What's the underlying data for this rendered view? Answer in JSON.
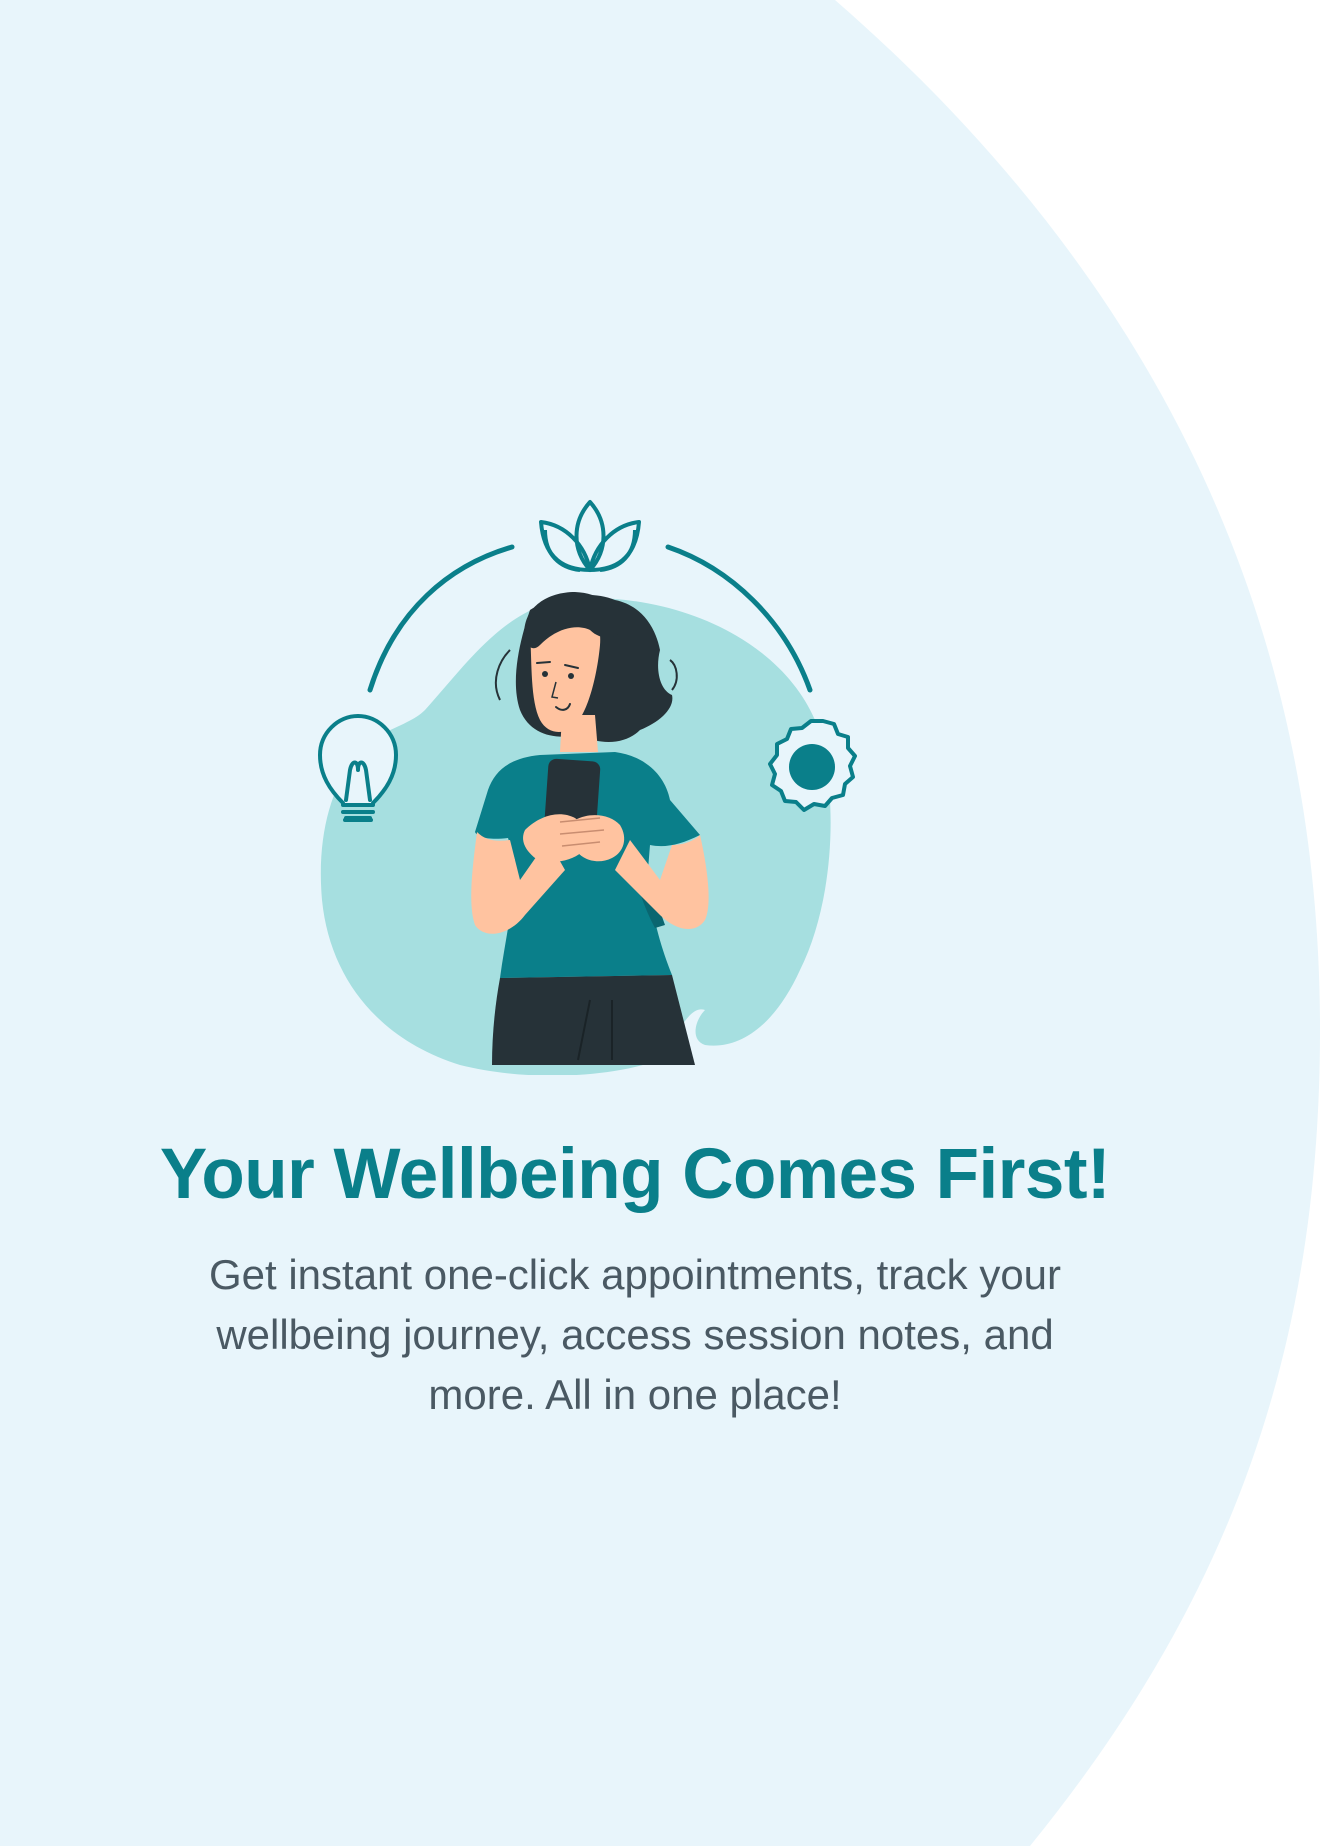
{
  "onboarding": {
    "headline": "Your Wellbeing Comes First!",
    "description": "Get instant one-click appointments, track your wellbeing journey, access session notes, and more. All in one place!"
  },
  "illustration": {
    "subject": "woman-using-phone",
    "icons": [
      "lotus-icon",
      "lightbulb-icon",
      "gear-icon"
    ]
  },
  "colors": {
    "background_light": "#e8f5fb",
    "accent_teal": "#0a7f8a",
    "blob": "#a6dfe0",
    "hair_dark": "#263238",
    "skin": "#ffc3a0",
    "body_text": "#4a5963"
  }
}
